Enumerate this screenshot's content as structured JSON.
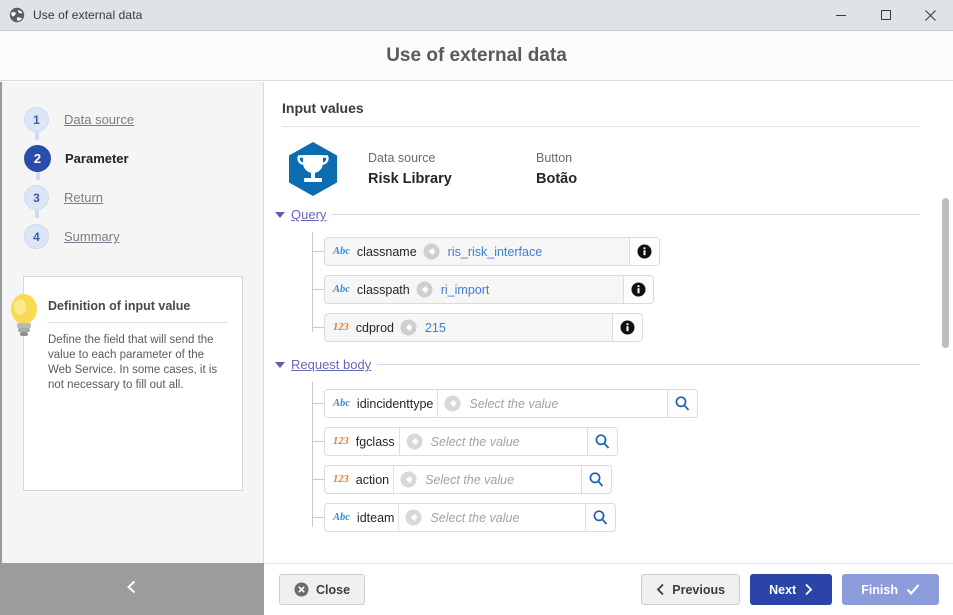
{
  "titlebar": {
    "icon": "globe-icon",
    "title": "Use of external data",
    "minimize": "–",
    "maximize": "□",
    "close": "✕"
  },
  "dialog": {
    "title": "Use of external data"
  },
  "sidebar": {
    "steps": [
      {
        "number": "1",
        "label": "Data source",
        "state": "done"
      },
      {
        "number": "2",
        "label": "Parameter",
        "state": "active"
      },
      {
        "number": "3",
        "label": "Return",
        "state": "todo"
      },
      {
        "number": "4",
        "label": "Summary",
        "state": "todo"
      }
    ],
    "tip": {
      "icon": "lightbulb-icon",
      "title": "Definition of input value",
      "body": "Define the field that will send the value to each parameter of the Web Service. In some cases, it is not necessary to fill out all."
    },
    "collapse_icon": "chevron-left-icon"
  },
  "main": {
    "heading": "Input values",
    "source": {
      "icon": "trophy-hexagon-icon",
      "datasource_label": "Data source",
      "datasource_value": "Risk Library",
      "button_label": "Button",
      "button_value": "Botão"
    },
    "sections": [
      {
        "title": "Query",
        "fields": [
          {
            "type": "Abc",
            "name": "classname",
            "value": "ris_risk_interface",
            "placeholder": "",
            "action": "info-icon"
          },
          {
            "type": "Abc",
            "name": "classpath",
            "value": "ri_import",
            "placeholder": "",
            "action": "info-icon"
          },
          {
            "type": "123",
            "name": "cdprod",
            "value": "215",
            "placeholder": "",
            "action": "info-icon"
          }
        ]
      },
      {
        "title": "Request body",
        "fields": [
          {
            "type": "Abc",
            "name": "idincidenttype",
            "value": "",
            "placeholder": "Select the value",
            "action": "search-icon"
          },
          {
            "type": "123",
            "name": "fgclass",
            "value": "",
            "placeholder": "Select the value",
            "action": "search-icon"
          },
          {
            "type": "123",
            "name": "action",
            "value": "",
            "placeholder": "Select the value",
            "action": "search-icon"
          },
          {
            "type": "Abc",
            "name": "idteam",
            "value": "",
            "placeholder": "Select the value",
            "action": "search-icon"
          }
        ]
      }
    ]
  },
  "footer": {
    "close": "Close",
    "previous": "Previous",
    "next": "Next",
    "finish": "Finish",
    "close_icon": "close-circle-icon",
    "prev_icon": "chevron-left-icon",
    "next_icon": "chevron-right-icon",
    "finish_icon": "check-icon"
  },
  "colors": {
    "accent_blue": "#2b44a8",
    "light_blue": "#8d9ddb",
    "section_purple": "#6767b8",
    "value_blue": "#3b7fd4",
    "type_abc": "#2f8fe0",
    "type_num": "#ef7a1f"
  }
}
